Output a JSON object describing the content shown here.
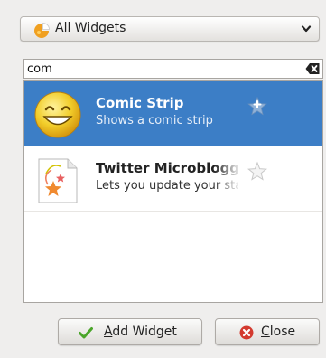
{
  "category": {
    "selected": "All Widgets",
    "icon": "widgets-icon",
    "arrow_icon": "chevron-down-icon"
  },
  "search": {
    "value": "com",
    "clear_icon": "clear-text-icon"
  },
  "widgets": [
    {
      "title": "Comic Strip",
      "description": "Shows a comic strip",
      "icon": "smiley-icon",
      "favorite_icon": "star-add-icon",
      "selected": true
    },
    {
      "title": "Twitter Microblogging",
      "description": "Lets you update your status",
      "icon": "microblog-icon",
      "favorite_icon": "star-icon",
      "selected": false
    }
  ],
  "buttons": {
    "add": {
      "label": "Add Widget",
      "icon": "checkmark-icon"
    },
    "close": {
      "label": "Close",
      "icon": "close-icon"
    }
  },
  "colors": {
    "selection": "#3c7ec6",
    "window_bg": "#efeeed",
    "check_green": "#4aa52a",
    "close_red": "#d33a2f"
  }
}
